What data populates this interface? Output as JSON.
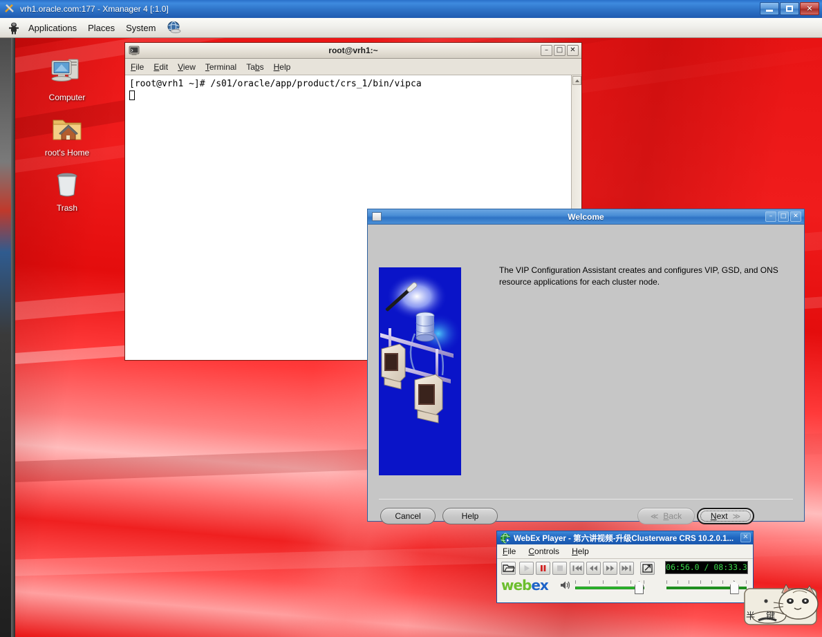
{
  "xmanager": {
    "title": "vrh1.oracle.com:177 - Xmanager 4 [:1.0]",
    "icon": "xmanager-icon",
    "buttons": {
      "minimize": "minimize-button",
      "maximize": "maximize-button",
      "close": "✕"
    }
  },
  "gnome_panel": {
    "logo_icon": "redhat-icon",
    "menus": [
      "Applications",
      "Places",
      "System"
    ],
    "launcher_icon": "globe-browser-icon"
  },
  "desktop": {
    "icons": [
      {
        "label": "Computer",
        "icon": "computer-icon"
      },
      {
        "label": "root's Home",
        "icon": "home-folder-icon"
      },
      {
        "label": "Trash",
        "icon": "trash-icon"
      }
    ]
  },
  "terminal": {
    "title": "root@vrh1:~",
    "icon": "terminal-icon",
    "menus": [
      "File",
      "Edit",
      "View",
      "Terminal",
      "Tabs",
      "Help"
    ],
    "menu_mnemonics": [
      "F",
      "E",
      "V",
      "T",
      "b",
      "H"
    ],
    "buttons": {
      "minimize": "–",
      "maximize": "□",
      "close": "✕"
    },
    "lines": [
      "[root@vrh1 ~]# /s01/oracle/app/product/crs_1/bin/vipca"
    ]
  },
  "vipca": {
    "title": "Welcome",
    "icon": "window-icon",
    "buttons": {
      "minimize": "–",
      "maximize": "□",
      "close": "✕"
    },
    "body_text": "The VIP Configuration Assistant creates and configures VIP, GSD, and ONS resource applications for each cluster node.",
    "splash_icon": "oracle-cluster-splash-image",
    "actions": {
      "cancel": "Cancel",
      "help": "Help",
      "back": "Back",
      "back_mnemonic": "B",
      "back_arrow": "≪",
      "next": "Next",
      "next_mnemonic": "N",
      "next_arrow": "≫"
    }
  },
  "webex": {
    "title": "WebEx Player - 第六讲视频-升级Clusterware CRS 10.2.0.1...",
    "icon": "webex-globe-icon",
    "close": "✕",
    "menus": [
      "File",
      "Controls",
      "Help"
    ],
    "menu_mnemonics": [
      "F",
      "C",
      "H"
    ],
    "toolbar": [
      {
        "name": "open-file-button",
        "glyph": "🗁",
        "state": "enabled"
      },
      {
        "name": "play-button",
        "glyph": "▶",
        "state": "disabled"
      },
      {
        "name": "pause-button",
        "glyph": "❙❙",
        "state": "active"
      },
      {
        "name": "stop-button",
        "glyph": "■",
        "state": "disabled"
      },
      {
        "name": "previous-track-button",
        "glyph": "❘◀◀",
        "state": "enabled"
      },
      {
        "name": "rewind-button",
        "glyph": "◀◀",
        "state": "enabled"
      },
      {
        "name": "fast-forward-button",
        "glyph": "▶▶",
        "state": "enabled"
      },
      {
        "name": "next-track-button",
        "glyph": "▶▶❘",
        "state": "enabled"
      },
      {
        "name": "fullscreen-button",
        "glyph": "↗",
        "state": "enabled"
      }
    ],
    "time_display": "06:56.0 / 08:33.3",
    "logo_text_1": "web",
    "logo_text_2": "ex",
    "volume_icon": "speaker-icon",
    "volume_percent": 88,
    "seek_percent": 81,
    "colors": {
      "logo_green": "#6cbe2e",
      "logo_blue": "#1e64c8",
      "time_green": "#3bd84a"
    }
  },
  "overlay": {
    "cat_icon": "cat-sticker-icon",
    "cat_text": "半 键"
  }
}
